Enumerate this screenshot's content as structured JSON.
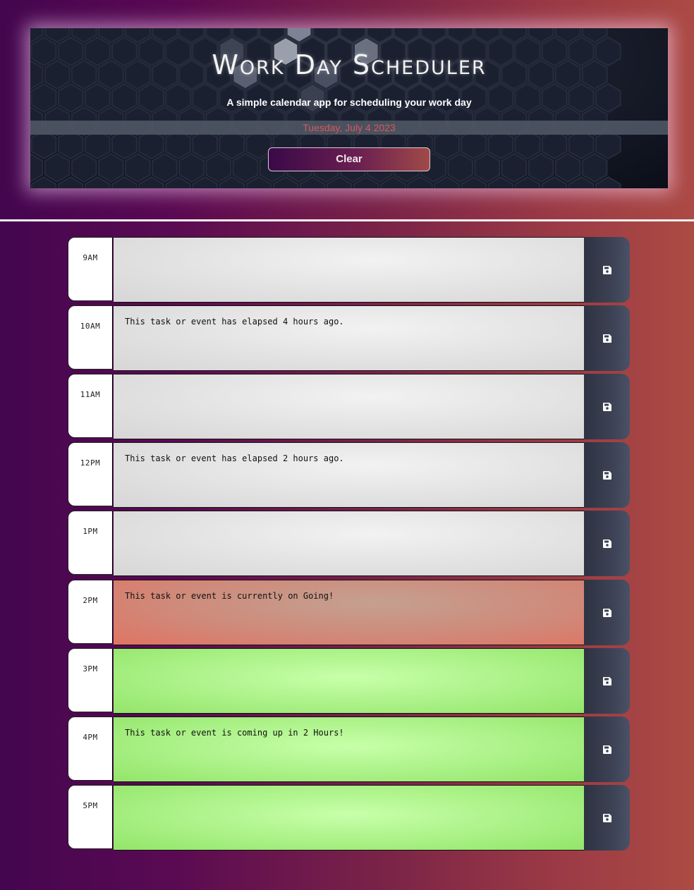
{
  "header": {
    "title": "Work Day Scheduler",
    "subtitle": "A simple calendar app for scheduling your work day",
    "date": "Tuesday, July 4 2023",
    "clear_label": "Clear"
  },
  "rows": [
    {
      "hour": "9AM",
      "text": "",
      "state": "past"
    },
    {
      "hour": "10AM",
      "text": "This task or event has elapsed 4 hours ago.",
      "state": "past"
    },
    {
      "hour": "11AM",
      "text": "",
      "state": "past"
    },
    {
      "hour": "12PM",
      "text": "This task or event has elapsed 2 hours ago.",
      "state": "past"
    },
    {
      "hour": "1PM",
      "text": "",
      "state": "past"
    },
    {
      "hour": "2PM",
      "text": "This task or event is currently on Going!",
      "state": "present"
    },
    {
      "hour": "3PM",
      "text": "",
      "state": "future"
    },
    {
      "hour": "4PM",
      "text": "This task or event is coming up in 2 Hours!",
      "state": "future"
    },
    {
      "hour": "5PM",
      "text": "",
      "state": "future"
    }
  ],
  "icons": {
    "save": "save-icon"
  },
  "colors": {
    "past": "#e2e2e2",
    "present": "#cf8a7a",
    "future": "#b2f590",
    "date_text": "#d65a5a"
  }
}
